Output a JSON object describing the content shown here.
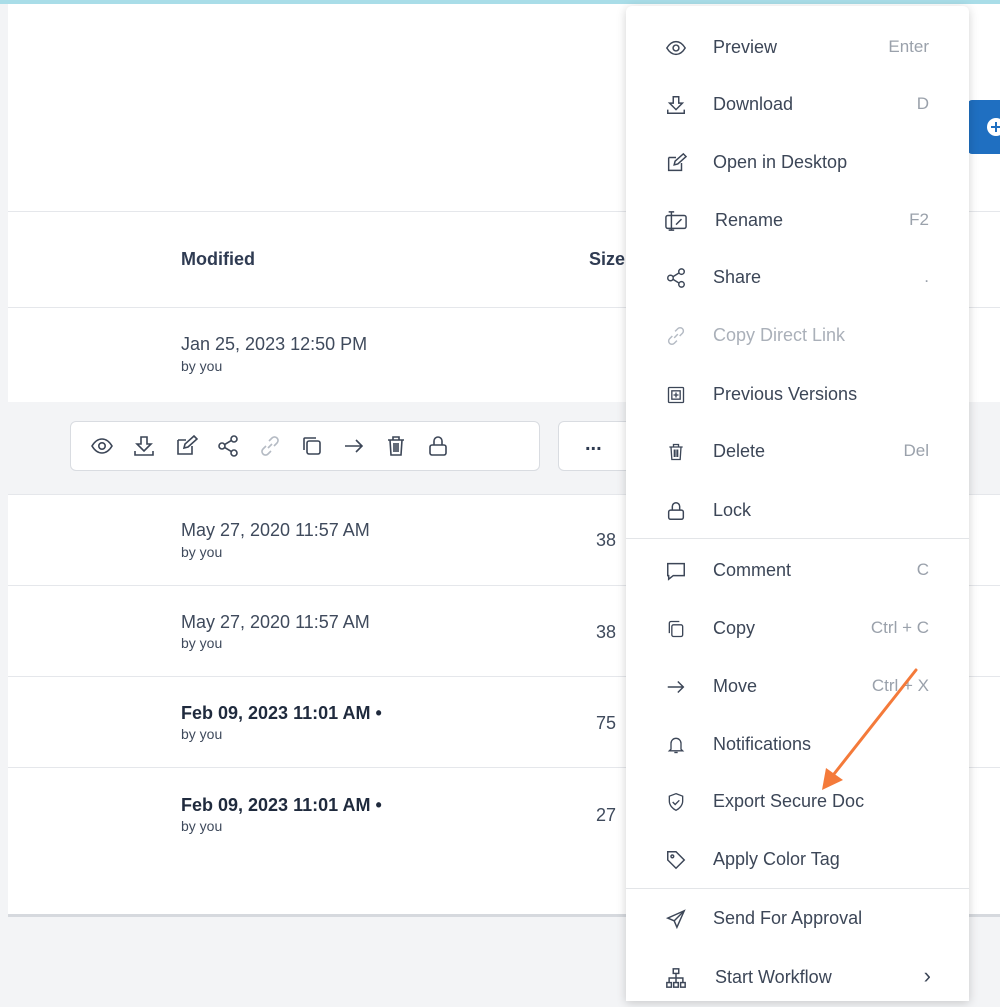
{
  "table": {
    "headers": {
      "modified": "Modified",
      "size": "Size"
    },
    "rows": [
      {
        "date": "Jan 25, 2023 12:50 PM",
        "by": "by you",
        "size": ""
      },
      {
        "date": "May 27, 2020 11:57 AM",
        "by": "by you",
        "size": "38"
      },
      {
        "date": "May 27, 2020 11:57 AM",
        "by": "by you",
        "size": "38"
      },
      {
        "date": "Feb 09, 2023 11:01 AM •",
        "by": "by you",
        "size": "75"
      },
      {
        "date": "Feb 09, 2023 11:01 AM •",
        "by": "by you",
        "size": "27"
      }
    ]
  },
  "action_bar": {
    "icons": [
      "eye-icon",
      "download-icon",
      "edit-icon",
      "share-icon",
      "link-icon",
      "copy-icon",
      "move-arrow-icon",
      "trash-icon",
      "lock-icon"
    ],
    "more_label": "..."
  },
  "context_menu": {
    "items": [
      {
        "label": "Preview",
        "shortcut": "Enter",
        "icon": "eye-icon"
      },
      {
        "label": "Download",
        "shortcut": "D",
        "icon": "download-icon"
      },
      {
        "label": "Open in Desktop",
        "shortcut": "",
        "icon": "edit-icon"
      },
      {
        "label": "Rename",
        "shortcut": "F2",
        "icon": "rename-icon"
      },
      {
        "label": "Share",
        "shortcut": ".",
        "icon": "share-icon"
      },
      {
        "label": "Copy Direct Link",
        "shortcut": "",
        "icon": "link-icon",
        "disabled": true
      },
      {
        "label": "Previous Versions",
        "shortcut": "",
        "icon": "versions-icon"
      },
      {
        "label": "Delete",
        "shortcut": "Del",
        "icon": "trash-icon"
      },
      {
        "label": "Lock",
        "shortcut": "",
        "icon": "lock-icon"
      },
      {
        "label": "Comment",
        "shortcut": "C",
        "icon": "comment-icon"
      },
      {
        "label": "Copy",
        "shortcut": "Ctrl + C",
        "icon": "copy-icon"
      },
      {
        "label": "Move",
        "shortcut": "Ctrl + X",
        "icon": "move-arrow-icon"
      },
      {
        "label": "Notifications",
        "shortcut": "",
        "icon": "bell-icon"
      },
      {
        "label": "Export Secure Doc",
        "shortcut": "",
        "icon": "shield-icon"
      },
      {
        "label": "Apply Color Tag",
        "shortcut": "",
        "icon": "tag-icon"
      },
      {
        "label": "Send For Approval",
        "shortcut": "",
        "icon": "send-icon"
      },
      {
        "label": "Start Workflow",
        "shortcut": "",
        "icon": "workflow-icon",
        "submenu": true
      }
    ]
  },
  "colors": {
    "accent_blue": "#1f6fc1",
    "annotation_arrow": "#f47a3a",
    "top_line": "#a9dde8"
  }
}
